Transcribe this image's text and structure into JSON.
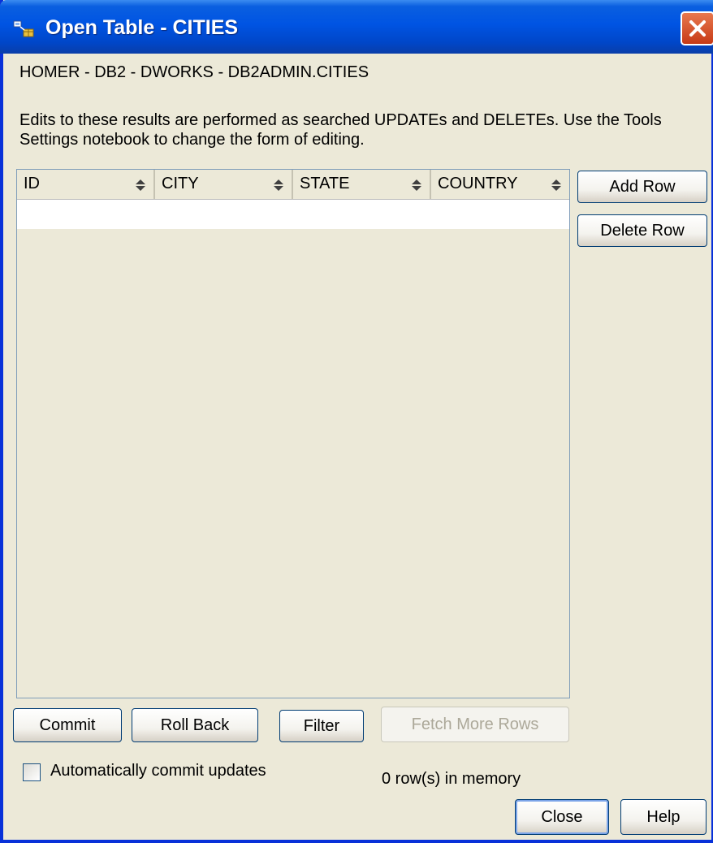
{
  "window": {
    "title": "Open Table - CITIES",
    "colors": {
      "titlebar": "#0054e3",
      "close_button": "#d8532a",
      "face": "#ece9d8"
    }
  },
  "path": "HOMER - DB2 - DWORKS - DB2ADMIN.CITIES",
  "info": "Edits to these results are performed as searched UPDATEs and DELETEs.  Use the Tools Settings notebook to change the form of editing.",
  "table": {
    "columns": [
      {
        "label": "ID",
        "sort_icon": "sort-updown-icon"
      },
      {
        "label": "CITY",
        "sort_icon": "sort-updown-icon"
      },
      {
        "label": "STATE",
        "sort_icon": "sort-updown-icon"
      },
      {
        "label": "COUNTRY",
        "sort_icon": "sort-updown-icon"
      }
    ],
    "rows": []
  },
  "side_buttons": {
    "add_row": "Add Row",
    "delete_row": "Delete Row"
  },
  "bottom_buttons": {
    "commit": "Commit",
    "roll_back": "Roll Back",
    "filter": "Filter",
    "fetch_more": "Fetch More Rows"
  },
  "auto_commit": {
    "label": "Automatically commit updates",
    "checked": false
  },
  "status": "0 row(s) in memory",
  "footer_buttons": {
    "close": "Close",
    "help": "Help"
  }
}
